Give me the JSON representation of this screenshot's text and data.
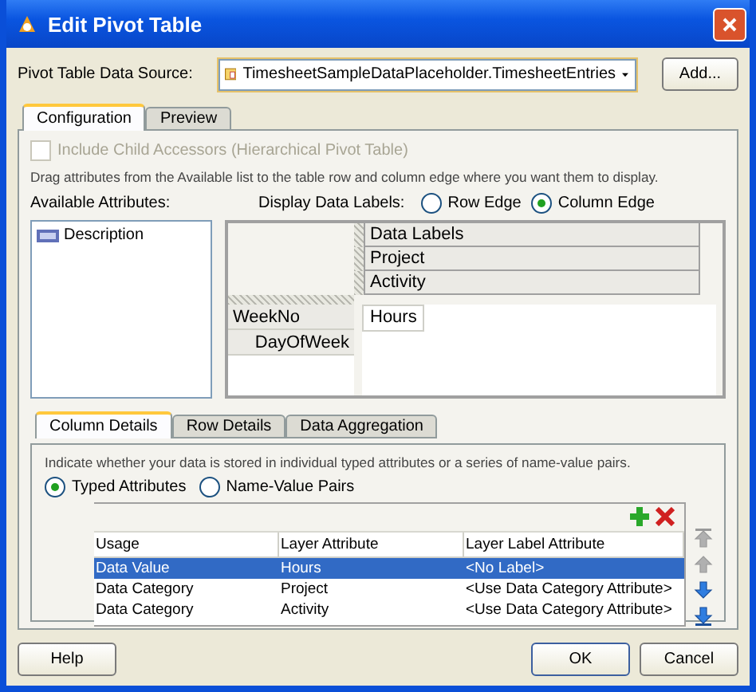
{
  "window": {
    "title": "Edit Pivot Table"
  },
  "data_source": {
    "label": "Pivot Table Data Source:",
    "value": "TimesheetSampleDataPlaceholder.TimesheetEntries",
    "button": "Add..."
  },
  "tabs": [
    {
      "label": "Configuration",
      "selected": true
    },
    {
      "label": "Preview",
      "selected": false
    }
  ],
  "include_child": {
    "label": "Include Child Accessors (Hierarchical Pivot Table)",
    "checked": false,
    "disabled": true
  },
  "instructions": "Drag attributes from the Available list to the table row and column edge where you want them to display.",
  "available_attributes": {
    "label": "Available Attributes:",
    "items": [
      "Description"
    ]
  },
  "display_data_labels": {
    "label": "Display Data Labels:",
    "options": [
      {
        "label": "Row Edge",
        "selected": false
      },
      {
        "label": "Column Edge",
        "selected": true
      }
    ]
  },
  "pivot": {
    "column_layers": [
      "Data Labels",
      "Project",
      "Activity"
    ],
    "row_layers": [
      "WeekNo",
      "DayOfWeek"
    ],
    "data_values": [
      "Hours"
    ]
  },
  "detail_tabs": [
    {
      "label": "Column Details",
      "selected": true
    },
    {
      "label": "Row Details",
      "selected": false
    },
    {
      "label": "Data Aggregation",
      "selected": false
    }
  ],
  "storage": {
    "hint": "Indicate whether your data is stored in individual typed attributes or a series of name-value pairs.",
    "options": [
      {
        "label": "Typed Attributes",
        "selected": true
      },
      {
        "label": "Name-Value Pairs",
        "selected": false
      }
    ]
  },
  "table": {
    "columns": [
      "Usage",
      "Layer Attribute",
      "Layer Label Attribute"
    ],
    "rows": [
      {
        "cells": [
          "Data Value",
          "Hours",
          "<No Label>"
        ],
        "selected": true
      },
      {
        "cells": [
          "Data Category",
          "Project",
          "<Use Data Category Attribute>"
        ],
        "selected": false
      },
      {
        "cells": [
          "Data Category",
          "Activity",
          "<Use Data Category Attribute>"
        ],
        "selected": false
      }
    ]
  },
  "buttons": {
    "help": "Help",
    "ok": "OK",
    "cancel": "Cancel"
  }
}
